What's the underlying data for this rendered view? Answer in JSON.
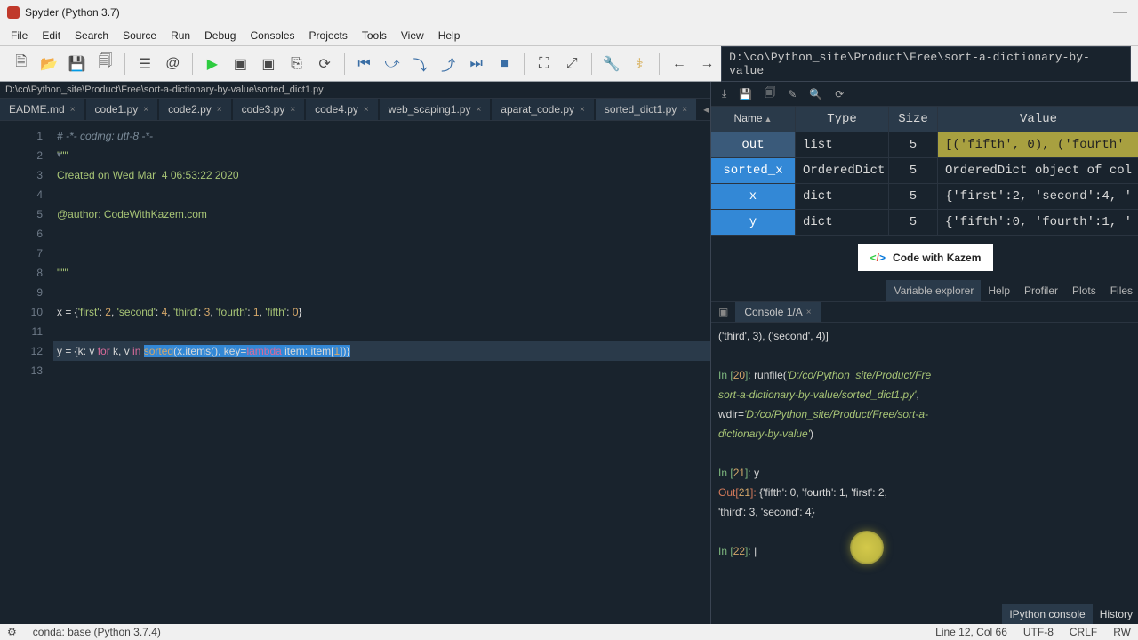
{
  "window": {
    "title": "Spyder (Python 3.7)"
  },
  "menu": [
    "File",
    "Edit",
    "Search",
    "Source",
    "Run",
    "Debug",
    "Consoles",
    "Projects",
    "Tools",
    "View",
    "Help"
  ],
  "path_field": "D:\\co\\Python_site\\Product\\Free\\sort-a-dictionary-by-value",
  "breadcrumb": "D:\\co\\Python_site\\Product\\Free\\sort-a-dictionary-by-value\\sorted_dict1.py",
  "editor_tabs": [
    "EADME.md",
    "code1.py",
    "code2.py",
    "code3.py",
    "code4.py",
    "web_scaping1.py",
    "aparat_code.py",
    "sorted_dict1.py"
  ],
  "active_tab": "sorted_dict1.py",
  "code": {
    "l1": "# -*- coding: utf-8 -*-",
    "l2": "\"\"\"",
    "l3": "Created on Wed Mar  4 06:53:22 2020",
    "l5": "@author: CodeWithKazem.com",
    "l8": "\"\"\"",
    "l10_a": "x = {",
    "l10_b": "'first'",
    "l10_c": "2",
    "l10_d": "'second'",
    "l10_e": "4",
    "l10_f": "'third'",
    "l10_g": "3",
    "l10_h": "'fourth'",
    "l10_i": "1",
    "l10_j": "'fifth'",
    "l10_k": "0",
    "l12_a": "y = {k: v ",
    "l12_for": "for",
    "l12_b": " k, v ",
    "l12_in": "in",
    "l12_c": " ",
    "l12_fn": "sorted",
    "l12_d": "(x.items(), key=",
    "l12_lam": "lambda",
    "l12_e": " item: item[",
    "l12_1": "1",
    "l12_f": "])}"
  },
  "var_headers": {
    "name": "Name",
    "type": "Type",
    "size": "Size",
    "value": "Value"
  },
  "vars": [
    {
      "name": "out",
      "type": "list",
      "size": "5",
      "value": "[('fifth', 0), ('fourth'"
    },
    {
      "name": "sorted_x",
      "type": "OrderedDict",
      "size": "5",
      "value": "OrderedDict object of col"
    },
    {
      "name": "x",
      "type": "dict",
      "size": "5",
      "value": "{'first':2, 'second':4, '"
    },
    {
      "name": "y",
      "type": "dict",
      "size": "5",
      "value": "{'fifth':0, 'fourth':1, '"
    }
  ],
  "logo_text": "Code with Kazem",
  "ve_panel_tabs": [
    "Variable explorer",
    "Help",
    "Profiler",
    "Plots",
    "Files"
  ],
  "console_tab": "Console 1/A",
  "console": {
    "top": "('third', 3), ('second', 4)]",
    "in20": "In [20]: ",
    "run_a": "runfile(",
    "run_p1": "'D:/co/Python_site/Product/Fre",
    "run_p2": "sort-a-dictionary-by-value/sorted_dict1.py'",
    "run_b": ",",
    "run_c": "wdir=",
    "run_p3": "'D:/co/Python_site/Product/Free/sort-a-",
    "run_p4": "dictionary-by-value'",
    "run_d": ")",
    "in21": "In [21]: ",
    "in21v": "y",
    "out21": "Out[21]: ",
    "out21v1": "{'fifth': 0, 'fourth': 1, 'first': 2,",
    "out21v2": "'third': 3, 'second': 4}",
    "in22": "In [22]: "
  },
  "bottom_tabs": [
    "IPython console",
    "History"
  ],
  "status": {
    "env": "conda: base (Python 3.7.4)",
    "pos": "Line 12, Col 66",
    "enc": "UTF-8",
    "eol": "CRLF",
    "rw": "RW"
  }
}
